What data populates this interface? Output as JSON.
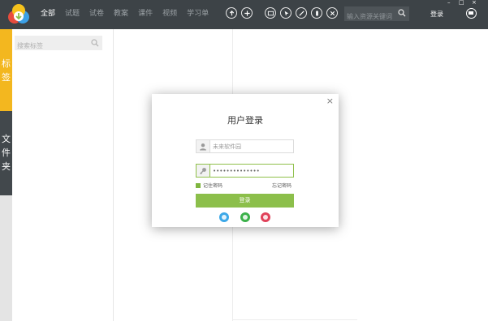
{
  "topbar": {
    "nav": [
      "全部",
      "试题",
      "试卷",
      "教案",
      "课件",
      "视频",
      "学习单"
    ],
    "search_placeholder": "输入资源关键词",
    "login_label": "登录",
    "window_controls": [
      "–",
      "□",
      "×"
    ],
    "tool_icons": [
      "upload-icon",
      "add-icon",
      "screen-icon",
      "pointer-icon",
      "pen-icon",
      "eraser-icon",
      "close-icon"
    ]
  },
  "left_tabs": {
    "tags_label": "标签",
    "folders_label": "文件夹"
  },
  "tag_panel": {
    "search_placeholder": "搜索标签"
  },
  "dialog": {
    "close_label": "×",
    "title": "用户登录",
    "username_placeholder": "未来软件园",
    "password_value": "••••••••••••••",
    "remember_label": "记住密码",
    "forgot_label": "忘记密码",
    "login_button": "登录",
    "social_icons": [
      "qq-icon",
      "wechat-icon",
      "weibo-icon"
    ]
  },
  "colors": {
    "topbar_bg": "#3d4347",
    "tags_tab": "#f3b71f",
    "folders_tab": "#42484c",
    "accent_green": "#8cbf4b"
  }
}
